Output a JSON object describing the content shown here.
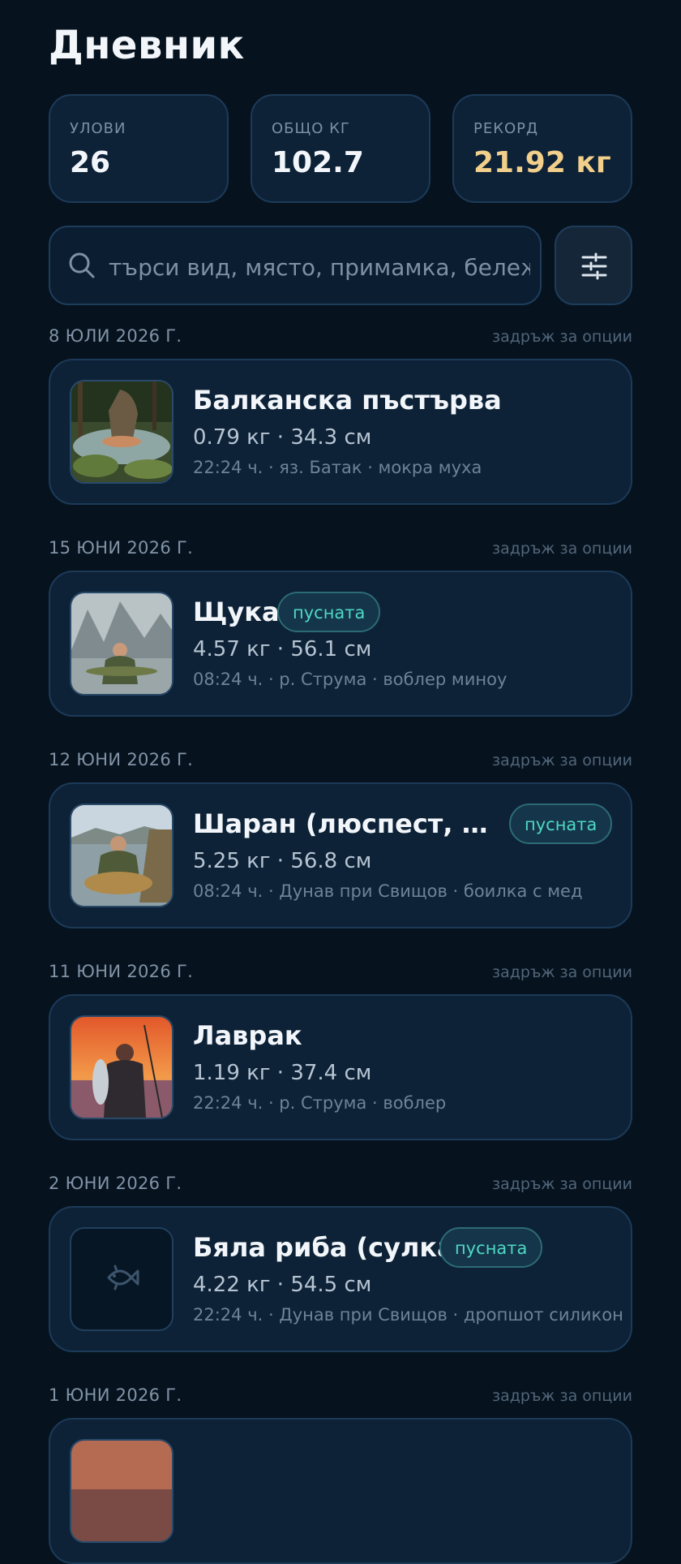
{
  "header": {
    "title": "Дневник"
  },
  "stats": [
    {
      "label": "УЛОВИ",
      "value": "26"
    },
    {
      "label": "ОБЩО КГ",
      "value": "102.7"
    },
    {
      "label": "РЕКОРД",
      "value": "21.92 кг",
      "color": "#f2cf8a"
    }
  ],
  "search": {
    "placeholder": "търси вид, място, примамка, бележка"
  },
  "hint": "задръж за опции",
  "groups": [
    {
      "date": "8 ЮЛИ 2026 Г.",
      "name": "Балканска пъстърва",
      "badge": "",
      "measure": "0.79 кг · 34.3 см",
      "meta": "22:24 ч. · яз. Батак · мокра муха"
    },
    {
      "date": "15 ЮНИ 2026 Г.",
      "name": "Щука",
      "badge": "пусната",
      "measure": "4.57 кг · 56.1 см",
      "meta": "08:24 ч. · р. Струма · воблер миноу"
    },
    {
      "date": "12 ЮНИ 2026 Г.",
      "name": "Шаран (люспест, ог...",
      "badge": "пусната",
      "measure": "5.25 кг · 56.8 см",
      "meta": "08:24 ч. · Дунав при Свищов · боилка с мед"
    },
    {
      "date": "11 ЮНИ 2026 Г.",
      "name": "Лаврак",
      "badge": "",
      "measure": "1.19 кг · 37.4 см",
      "meta": "22:24 ч. · р. Струма · воблер"
    },
    {
      "date": "2 ЮНИ 2026 Г.",
      "name": "Бяла риба (сулка)",
      "badge": "пусната",
      "measure": "4.22 кг · 54.5 см",
      "meta": "22:24 ч. · Дунав при Свищов · дропшот силикон"
    },
    {
      "date": "1 ЮНИ 2026 Г.",
      "name": "",
      "badge": "",
      "measure": "",
      "meta": ""
    }
  ],
  "colors": {
    "background": "#06131f",
    "card": "#0d2237",
    "accent_badge": "#4fd8c3",
    "record": "#f2cf8a"
  },
  "icons": {
    "search": "search-icon",
    "filter": "sliders-icon",
    "placeholder": "fish-icon"
  }
}
